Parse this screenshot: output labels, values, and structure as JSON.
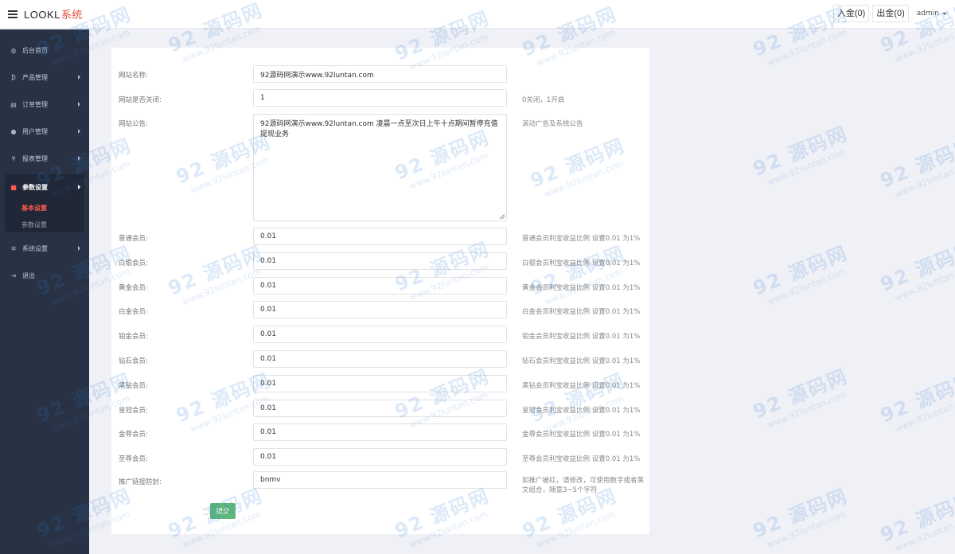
{
  "header": {
    "brand_main": "LOOKL",
    "brand_accent": "系统",
    "deposit_label": "入金(0)",
    "withdraw_label": "出金(0)",
    "user": "admin"
  },
  "sidebar": {
    "items": [
      {
        "label": "后台首页",
        "icon": "dashboard-icon"
      },
      {
        "label": "产品管理",
        "icon": "bitcoin-icon"
      },
      {
        "label": "订单管理",
        "icon": "copy-icon"
      },
      {
        "label": "用户管理",
        "icon": "user-icon"
      },
      {
        "label": "报表管理",
        "icon": "yen-icon"
      },
      {
        "label": "参数设置",
        "icon": "files-icon"
      },
      {
        "label": "系统设置",
        "icon": "gears-icon"
      },
      {
        "label": "退出",
        "icon": "signout-icon"
      }
    ],
    "sub_items": [
      "基本设置",
      "参数设置"
    ]
  },
  "form": {
    "site_name": {
      "label": "网站名称:",
      "value": "92源码网演示www.92luntan.com"
    },
    "site_closed": {
      "label": "网站是否关闭:",
      "value": "1",
      "hint": "0关闭，1开启"
    },
    "notice": {
      "label": "网站公告:",
      "value": "92源码网演示www.92luntan.com  凌晨一点至次日上午十点期间暂停充值提现业务",
      "hint": "滚动广告及系统公告"
    },
    "levels": [
      {
        "label": "普通会员:",
        "value": "0.01",
        "hint": "普通会员利宝收益比例 设置0.01 为1%"
      },
      {
        "label": "白银会员:",
        "value": "0.01",
        "hint": "白银会员利宝收益比例 设置0.01 为1%"
      },
      {
        "label": "黄金会员:",
        "value": "0.01",
        "hint": "黄金会员利宝收益比例 设置0.01 为1%"
      },
      {
        "label": "白金会员:",
        "value": "0.01",
        "hint": "白金会员利宝收益比例 设置0.01 为1%"
      },
      {
        "label": "铂金会员:",
        "value": "0.01",
        "hint": "铂金会员利宝收益比例 设置0.01 为1%"
      },
      {
        "label": "钻石会员:",
        "value": "0.01",
        "hint": "钻石会员利宝收益比例 设置0.01 为1%"
      },
      {
        "label": "黑钻会员:",
        "value": "0.01",
        "hint": "黑钻会员利宝收益比例 设置0.01 为1%"
      },
      {
        "label": "皇冠会员:",
        "value": "0.01",
        "hint": "皇冠会员利宝收益比例 设置0.01 为1%"
      },
      {
        "label": "金尊会员:",
        "value": "0.01",
        "hint": "金尊会员利宝收益比例 设置0.01 为1%"
      },
      {
        "label": "至尊会员:",
        "value": "0.01",
        "hint": "至尊会员利宝收益比例 设置0.01 为1%"
      }
    ],
    "promo": {
      "label": "推广链接防封:",
      "value": "bnmv",
      "hint": "如推广被红，请修改，可使用数字或者英文组合，随意3~5个字符"
    },
    "submit_label": "提交"
  },
  "watermark": {
    "big": "92 源码网",
    "small": "www.92luntan.com"
  },
  "colors": {
    "sidebar": "#283244",
    "accent": "#ff5a4e",
    "submit": "#5fb878"
  }
}
